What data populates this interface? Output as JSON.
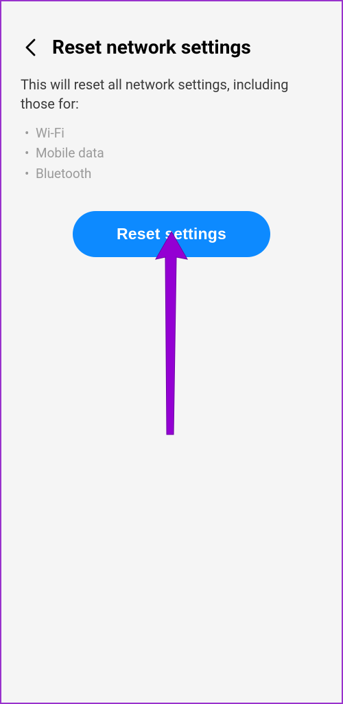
{
  "header": {
    "title": "Reset network settings"
  },
  "content": {
    "description": "This will reset all network settings, including those for:",
    "bullets": [
      "Wi-Fi",
      "Mobile data",
      "Bluetooth"
    ]
  },
  "button": {
    "label": "Reset settings"
  },
  "annotation": {
    "color": "#9400D3"
  }
}
